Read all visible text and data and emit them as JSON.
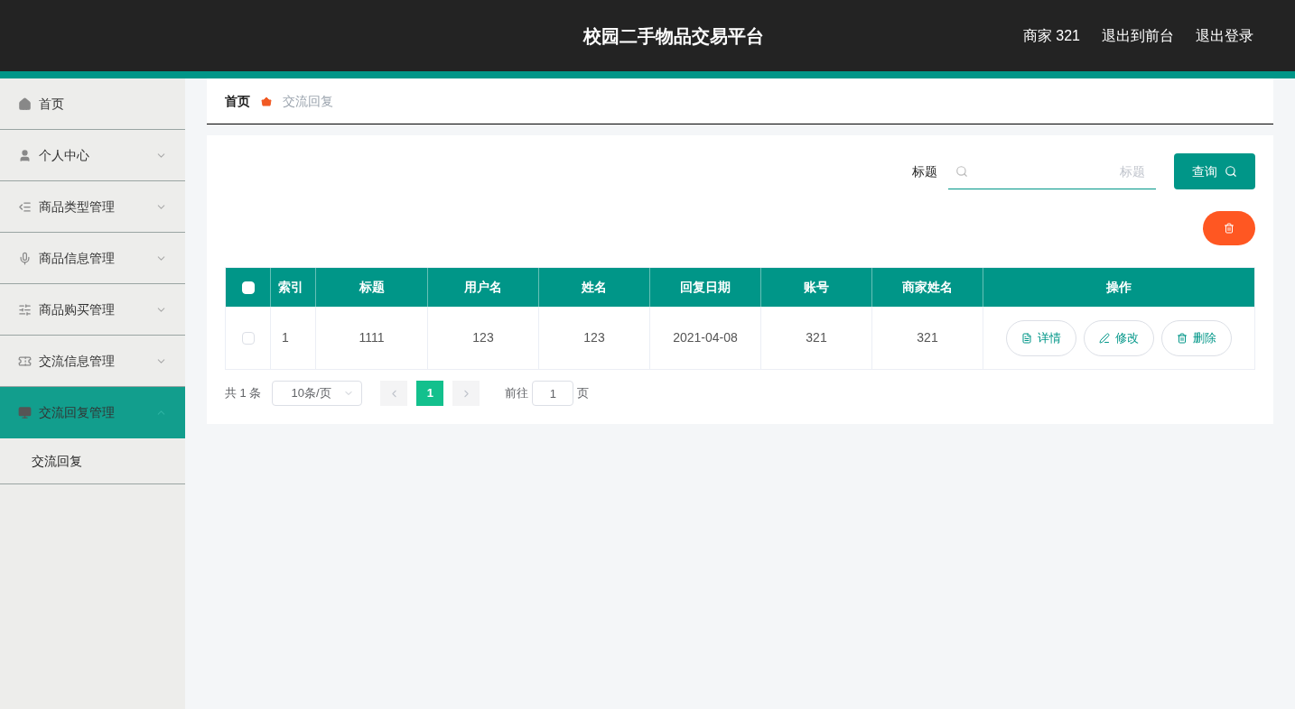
{
  "header": {
    "title": "校园二手物品交易平台",
    "user": "商家 321",
    "links": [
      "退出到前台",
      "退出登录"
    ]
  },
  "sidebar": {
    "items": [
      {
        "label": "首页",
        "selected": false
      },
      {
        "label": "个人中心",
        "selected": false,
        "expanded": false
      },
      {
        "label": "商品类型管理",
        "selected": false,
        "expanded": false
      },
      {
        "label": "商品信息管理",
        "selected": false,
        "expanded": false
      },
      {
        "label": "商品购买管理",
        "selected": false,
        "expanded": false
      },
      {
        "label": "交流信息管理",
        "selected": false,
        "expanded": false
      },
      {
        "label": "交流回复管理",
        "selected": true,
        "expanded": true,
        "children": [
          {
            "label": "交流回复",
            "selected": false
          }
        ]
      }
    ]
  },
  "breadcrumb": [
    "首页",
    "交流回复"
  ],
  "search": {
    "label": "标题",
    "placeholder": "标题",
    "button": "查询"
  },
  "table": {
    "header_checkbox": {
      "checked": false
    },
    "columns": [
      "索引",
      "标题",
      "用户名",
      "姓名",
      "回复日期",
      "账号",
      "商家姓名",
      "操作"
    ],
    "rows": [
      {
        "checked": false,
        "cells": [
          "1",
          "1111",
          "123",
          "123",
          "2021-04-08",
          "321",
          "321"
        ],
        "actions": [
          "详情",
          "修改",
          "删除"
        ]
      }
    ]
  },
  "pagination": {
    "total": "共 1 条",
    "page_size": "10条/页",
    "pages": [
      {
        "label": "1",
        "selected": true
      }
    ],
    "goto_label": "前往",
    "goto_value": "1",
    "goto_suffix": "页"
  }
}
